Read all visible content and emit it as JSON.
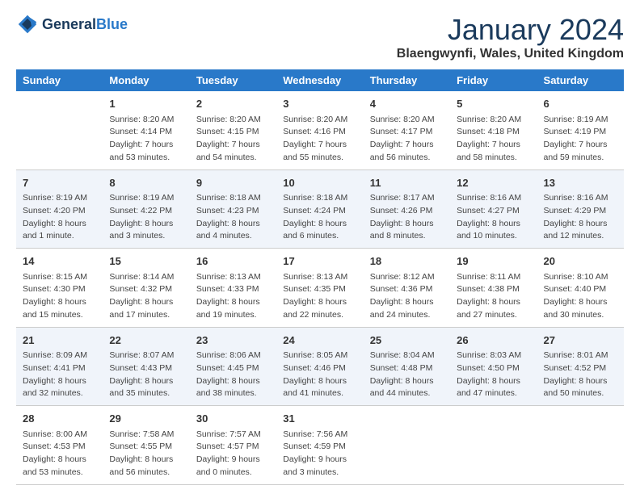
{
  "header": {
    "logo_general": "General",
    "logo_blue": "Blue",
    "month_title": "January 2024",
    "location": "Blaengwynfi, Wales, United Kingdom"
  },
  "weekdays": [
    "Sunday",
    "Monday",
    "Tuesday",
    "Wednesday",
    "Thursday",
    "Friday",
    "Saturday"
  ],
  "weeks": [
    [
      {
        "day": "",
        "info": ""
      },
      {
        "day": "1",
        "info": "Sunrise: 8:20 AM\nSunset: 4:14 PM\nDaylight: 7 hours\nand 53 minutes."
      },
      {
        "day": "2",
        "info": "Sunrise: 8:20 AM\nSunset: 4:15 PM\nDaylight: 7 hours\nand 54 minutes."
      },
      {
        "day": "3",
        "info": "Sunrise: 8:20 AM\nSunset: 4:16 PM\nDaylight: 7 hours\nand 55 minutes."
      },
      {
        "day": "4",
        "info": "Sunrise: 8:20 AM\nSunset: 4:17 PM\nDaylight: 7 hours\nand 56 minutes."
      },
      {
        "day": "5",
        "info": "Sunrise: 8:20 AM\nSunset: 4:18 PM\nDaylight: 7 hours\nand 58 minutes."
      },
      {
        "day": "6",
        "info": "Sunrise: 8:19 AM\nSunset: 4:19 PM\nDaylight: 7 hours\nand 59 minutes."
      }
    ],
    [
      {
        "day": "7",
        "info": "Sunrise: 8:19 AM\nSunset: 4:20 PM\nDaylight: 8 hours\nand 1 minute."
      },
      {
        "day": "8",
        "info": "Sunrise: 8:19 AM\nSunset: 4:22 PM\nDaylight: 8 hours\nand 3 minutes."
      },
      {
        "day": "9",
        "info": "Sunrise: 8:18 AM\nSunset: 4:23 PM\nDaylight: 8 hours\nand 4 minutes."
      },
      {
        "day": "10",
        "info": "Sunrise: 8:18 AM\nSunset: 4:24 PM\nDaylight: 8 hours\nand 6 minutes."
      },
      {
        "day": "11",
        "info": "Sunrise: 8:17 AM\nSunset: 4:26 PM\nDaylight: 8 hours\nand 8 minutes."
      },
      {
        "day": "12",
        "info": "Sunrise: 8:16 AM\nSunset: 4:27 PM\nDaylight: 8 hours\nand 10 minutes."
      },
      {
        "day": "13",
        "info": "Sunrise: 8:16 AM\nSunset: 4:29 PM\nDaylight: 8 hours\nand 12 minutes."
      }
    ],
    [
      {
        "day": "14",
        "info": "Sunrise: 8:15 AM\nSunset: 4:30 PM\nDaylight: 8 hours\nand 15 minutes."
      },
      {
        "day": "15",
        "info": "Sunrise: 8:14 AM\nSunset: 4:32 PM\nDaylight: 8 hours\nand 17 minutes."
      },
      {
        "day": "16",
        "info": "Sunrise: 8:13 AM\nSunset: 4:33 PM\nDaylight: 8 hours\nand 19 minutes."
      },
      {
        "day": "17",
        "info": "Sunrise: 8:13 AM\nSunset: 4:35 PM\nDaylight: 8 hours\nand 22 minutes."
      },
      {
        "day": "18",
        "info": "Sunrise: 8:12 AM\nSunset: 4:36 PM\nDaylight: 8 hours\nand 24 minutes."
      },
      {
        "day": "19",
        "info": "Sunrise: 8:11 AM\nSunset: 4:38 PM\nDaylight: 8 hours\nand 27 minutes."
      },
      {
        "day": "20",
        "info": "Sunrise: 8:10 AM\nSunset: 4:40 PM\nDaylight: 8 hours\nand 30 minutes."
      }
    ],
    [
      {
        "day": "21",
        "info": "Sunrise: 8:09 AM\nSunset: 4:41 PM\nDaylight: 8 hours\nand 32 minutes."
      },
      {
        "day": "22",
        "info": "Sunrise: 8:07 AM\nSunset: 4:43 PM\nDaylight: 8 hours\nand 35 minutes."
      },
      {
        "day": "23",
        "info": "Sunrise: 8:06 AM\nSunset: 4:45 PM\nDaylight: 8 hours\nand 38 minutes."
      },
      {
        "day": "24",
        "info": "Sunrise: 8:05 AM\nSunset: 4:46 PM\nDaylight: 8 hours\nand 41 minutes."
      },
      {
        "day": "25",
        "info": "Sunrise: 8:04 AM\nSunset: 4:48 PM\nDaylight: 8 hours\nand 44 minutes."
      },
      {
        "day": "26",
        "info": "Sunrise: 8:03 AM\nSunset: 4:50 PM\nDaylight: 8 hours\nand 47 minutes."
      },
      {
        "day": "27",
        "info": "Sunrise: 8:01 AM\nSunset: 4:52 PM\nDaylight: 8 hours\nand 50 minutes."
      }
    ],
    [
      {
        "day": "28",
        "info": "Sunrise: 8:00 AM\nSunset: 4:53 PM\nDaylight: 8 hours\nand 53 minutes."
      },
      {
        "day": "29",
        "info": "Sunrise: 7:58 AM\nSunset: 4:55 PM\nDaylight: 8 hours\nand 56 minutes."
      },
      {
        "day": "30",
        "info": "Sunrise: 7:57 AM\nSunset: 4:57 PM\nDaylight: 9 hours\nand 0 minutes."
      },
      {
        "day": "31",
        "info": "Sunrise: 7:56 AM\nSunset: 4:59 PM\nDaylight: 9 hours\nand 3 minutes."
      },
      {
        "day": "",
        "info": ""
      },
      {
        "day": "",
        "info": ""
      },
      {
        "day": "",
        "info": ""
      }
    ]
  ]
}
